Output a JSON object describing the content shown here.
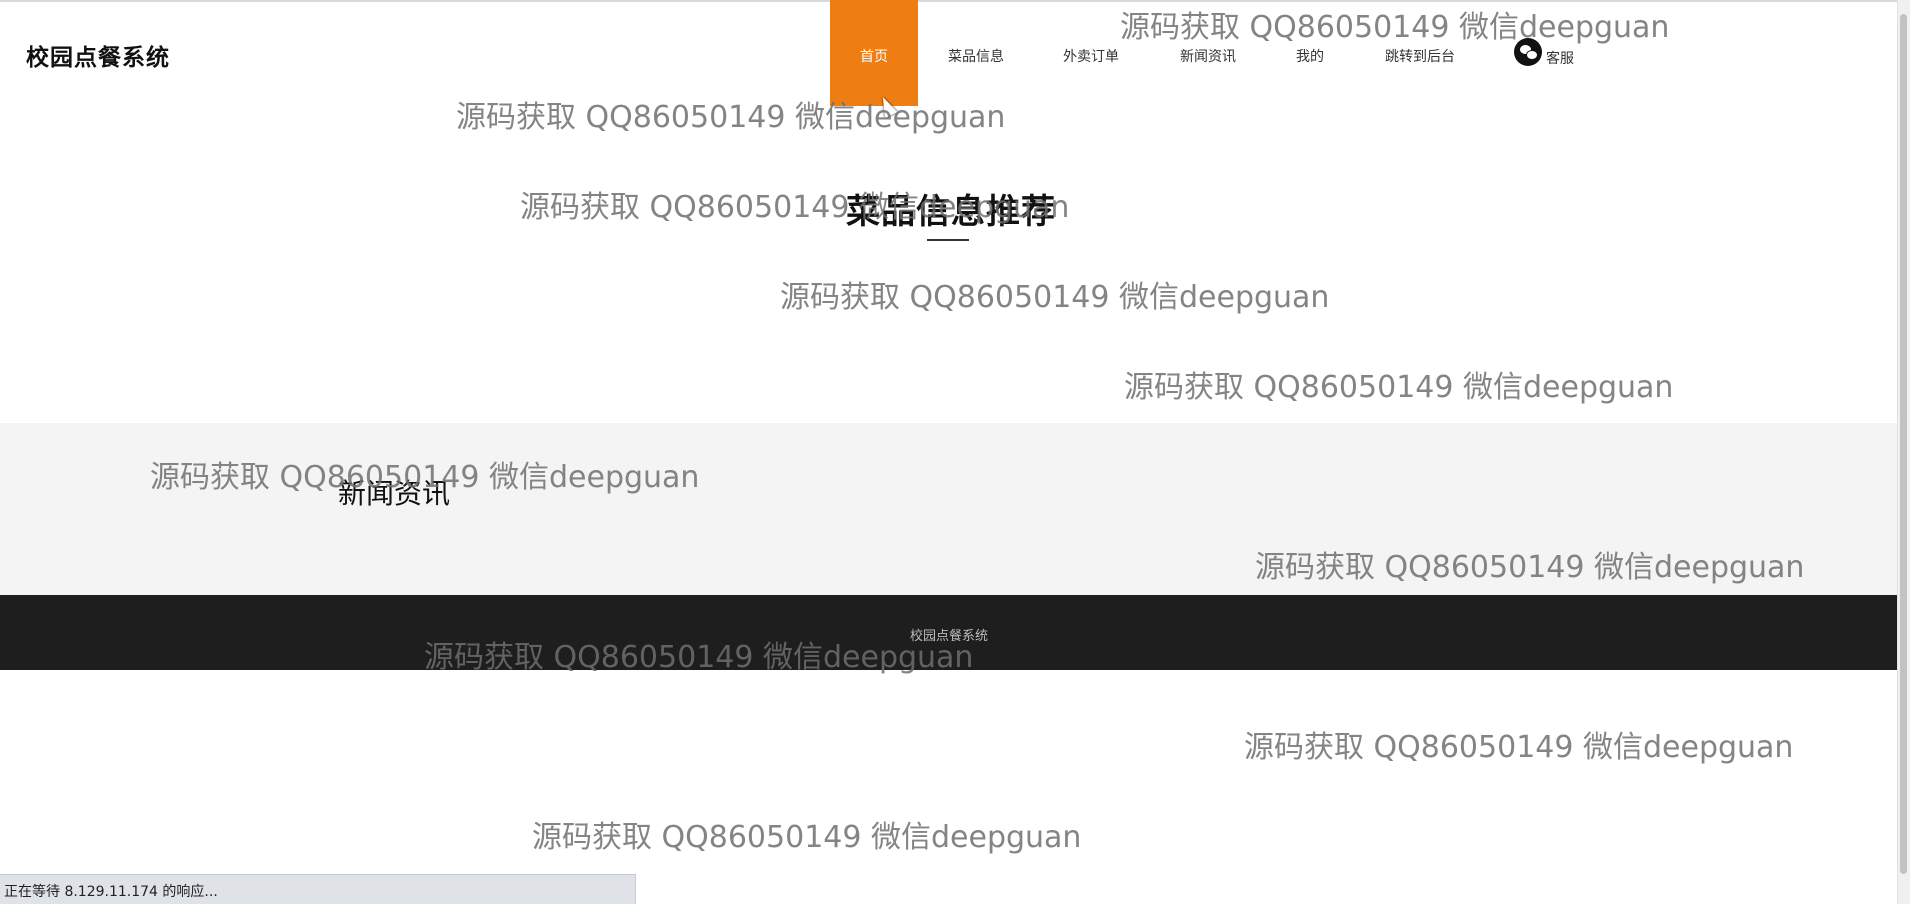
{
  "site": {
    "title": "校园点餐系统"
  },
  "nav": {
    "items": [
      {
        "label": "首页",
        "active": true
      },
      {
        "label": "菜品信息",
        "active": false
      },
      {
        "label": "外卖订单",
        "active": false
      },
      {
        "label": "新闻资讯",
        "active": false
      },
      {
        "label": "我的",
        "active": false
      },
      {
        "label": "跳转到后台",
        "active": false
      }
    ],
    "service": {
      "label": "客服",
      "icon": "wechat-icon"
    },
    "accent_color": "#ee7d14"
  },
  "sections": {
    "recommend_title": "菜品信息推荐",
    "news_title": "新闻资讯"
  },
  "footer": {
    "text": "校园点餐系统"
  },
  "watermark": {
    "text": "源码获取 QQ86050149 微信deepguan"
  },
  "status_bar": {
    "text": "正在等待 8.129.11.174 的响应..."
  },
  "colors": {
    "footer_bg": "#1e1e1e",
    "news_band_bg": "#f4f4f4"
  }
}
